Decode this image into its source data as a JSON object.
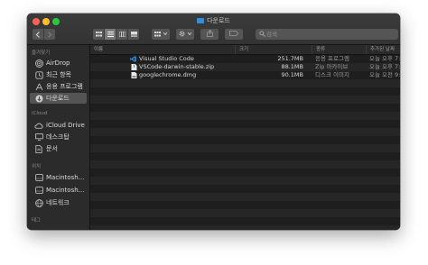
{
  "window": {
    "title": "다운로드"
  },
  "toolbar": {
    "back_icon": "chevron-left-icon",
    "forward_icon": "chevron-right-icon",
    "search_placeholder": "검색"
  },
  "sidebar": {
    "section_favorites": "즐겨찾기",
    "favorites": [
      {
        "label": "AirDrop",
        "icon": "airdrop-icon"
      },
      {
        "label": "최근 항목",
        "icon": "recents-icon"
      },
      {
        "label": "응용 프로그램",
        "icon": "applications-icon"
      },
      {
        "label": "다운로드",
        "icon": "downloads-icon",
        "selected": true
      }
    ],
    "section_icloud": "iCloud",
    "icloud": [
      {
        "label": "iCloud Drive",
        "icon": "cloud-icon"
      },
      {
        "label": "데스크탑",
        "icon": "desktop-icon"
      },
      {
        "label": "문서",
        "icon": "document-icon"
      }
    ],
    "section_locations": "위치",
    "locations": [
      {
        "label": "Macintosh...",
        "icon": "disk-icon"
      },
      {
        "label": "Macintosh...",
        "icon": "disk-icon"
      },
      {
        "label": "네트워크",
        "icon": "network-icon"
      }
    ],
    "section_tags": "태그"
  },
  "columns": {
    "name": "이름",
    "size": "크기",
    "kind": "종류",
    "date_added": "추가된 날짜"
  },
  "files": [
    {
      "name": "Visual Studio Code",
      "size": "251.7MB",
      "kind": "응용 프로그램",
      "date_added": "오늘 오후 7:47",
      "icon": "vscode-app-icon"
    },
    {
      "name": "VSCode-darwin-stable.zip",
      "size": "88.1MB",
      "kind": "Zip 아카이브",
      "date_added": "오늘 오후 7:35",
      "icon": "zip-file-icon"
    },
    {
      "name": "googlechrome.dmg",
      "size": "90.1MB",
      "kind": "디스크 이미지",
      "date_added": "오늘 오전 9:17",
      "icon": "dmg-file-icon"
    }
  ]
}
